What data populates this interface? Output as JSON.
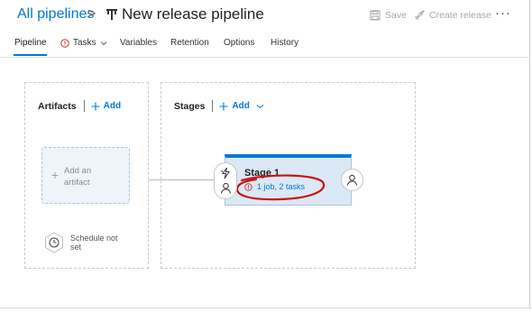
{
  "header": {
    "breadcrumb": "All pipelines",
    "separator": ">",
    "title": "New release pipeline",
    "save_label": "Save",
    "create_release_label": "Create release",
    "more_label": "···"
  },
  "tabs": [
    {
      "label": "Pipeline",
      "selected": true
    },
    {
      "label": "Tasks",
      "warning": true,
      "has_dropdown": true
    },
    {
      "label": "Variables"
    },
    {
      "label": "Retention"
    },
    {
      "label": "Options"
    },
    {
      "label": "History"
    }
  ],
  "artifacts": {
    "heading": "Artifacts",
    "add_label": "Add",
    "placeholder_plus": "+",
    "placeholder_label": "Add an artifact",
    "schedule_label": "Schedule not set"
  },
  "stages": {
    "heading": "Stages",
    "add_label": "Add",
    "items": [
      {
        "name": "Stage 1",
        "tasks_label": "1 job, 2 tasks",
        "warning": true
      }
    ]
  },
  "colors": {
    "accent": "#0078d4",
    "stage_fill": "#dbe8f5",
    "artifact_fill": "#eef4fa",
    "warning": "#d13438",
    "annotation": "#cc1111",
    "disabled": "#a6a6a6"
  },
  "icons": {
    "pipeline": "pipeline-icon",
    "save": "save-icon",
    "create_release": "rocket-icon",
    "more": "more-icon",
    "warning": "warning-icon",
    "add": "plus-icon",
    "dropdown": "chevron-down-icon",
    "schedule": "clock-icon",
    "trigger": "lightning-icon",
    "approver": "person-icon"
  }
}
